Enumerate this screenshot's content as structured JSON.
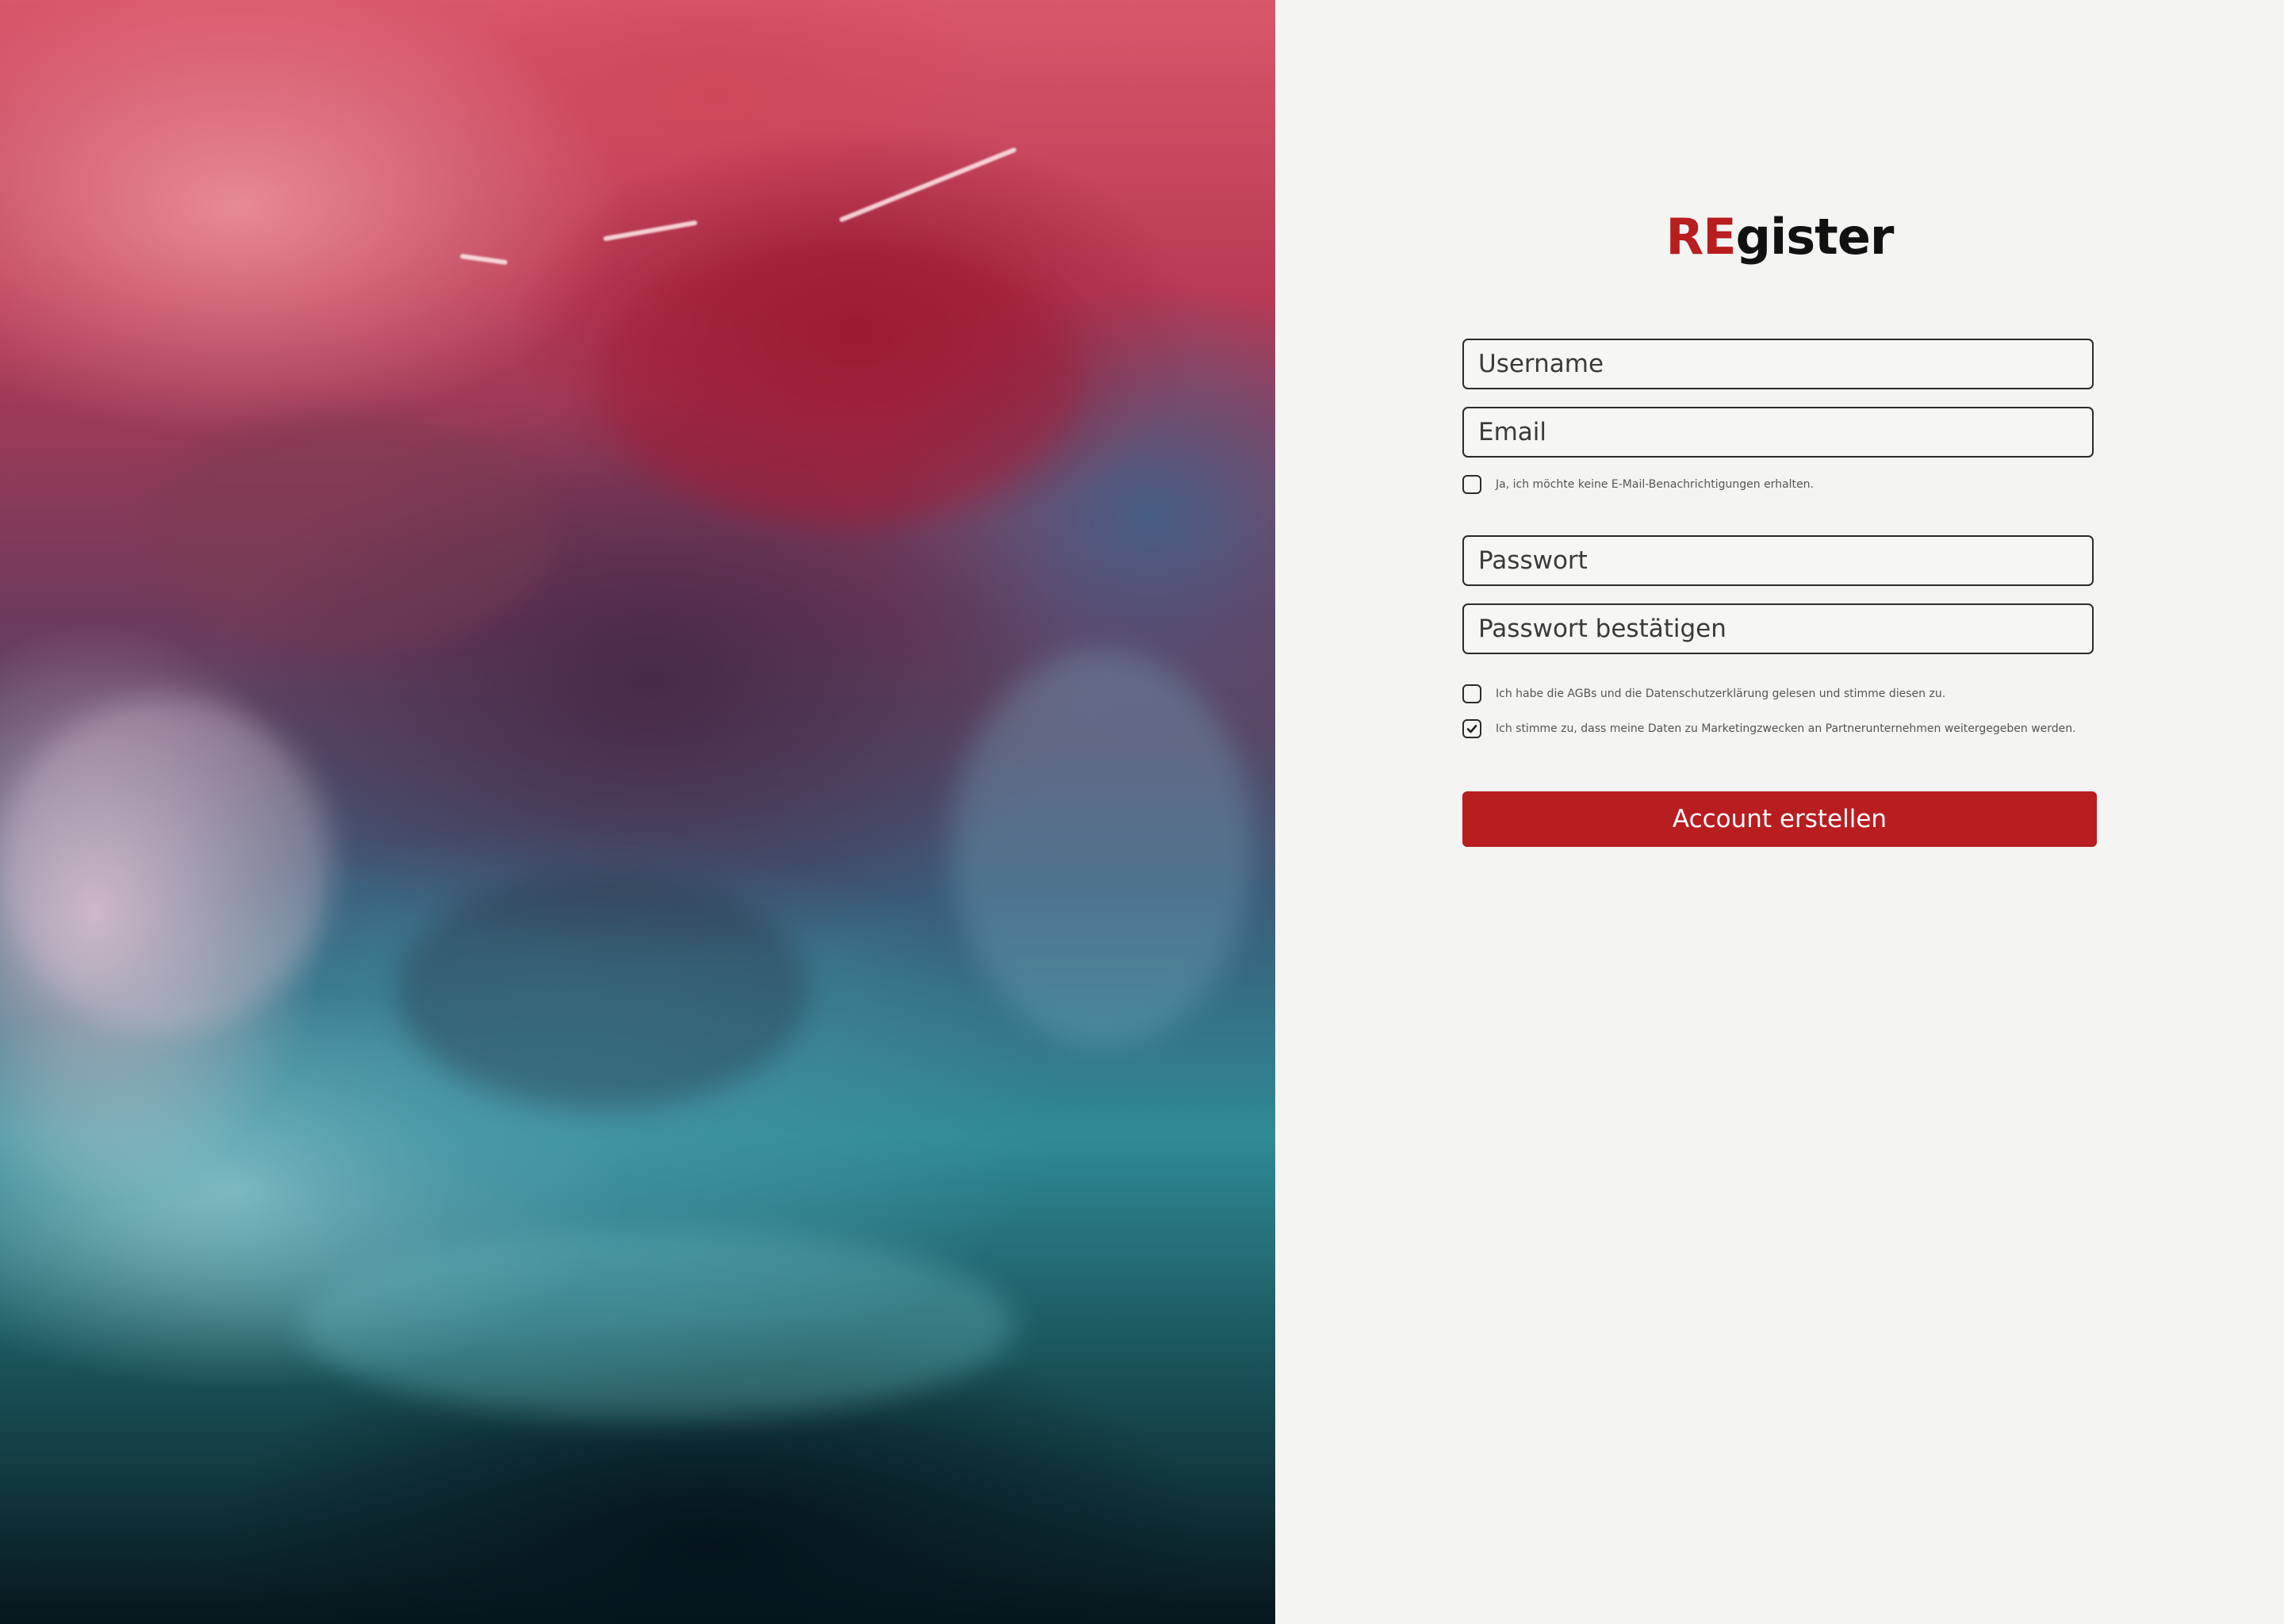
{
  "logo": {
    "accent": "RE",
    "rest": "gister"
  },
  "form": {
    "username": {
      "placeholder": "Username",
      "value": ""
    },
    "email": {
      "placeholder": "Email",
      "value": ""
    },
    "no_email_notifications": {
      "label": "Ja, ich möchte keine E-Mail-Benachrichtigungen erhalten.",
      "checked": false
    },
    "password": {
      "placeholder": "Passwort",
      "value": ""
    },
    "password_confirm": {
      "placeholder": "Passwort bestätigen",
      "value": ""
    },
    "terms": {
      "label": "Ich habe die AGBs und die Datenschutzerklärung gelesen und stimme diesen zu.",
      "checked": false
    },
    "marketing": {
      "label": "Ich stimme zu, dass meine Daten zu Marketingzwecken an Partnerunternehmen weitergegeben werden.",
      "checked": true
    },
    "submit_label": "Account erstellen"
  },
  "colors": {
    "accent": "#b81d20",
    "background": "#f4f4f2",
    "text": "#111111"
  },
  "icons": {
    "checkmark": "check-icon"
  }
}
